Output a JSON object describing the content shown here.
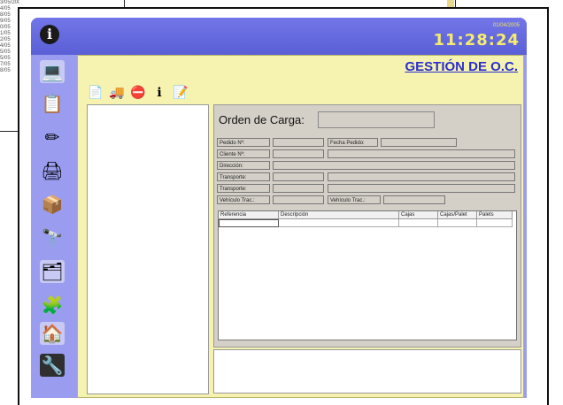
{
  "background": {
    "dates": [
      "3/05/2004",
      "4/05",
      "8/05",
      "9/05",
      "0/05",
      "1/05",
      "2/05",
      "4/05",
      "5/05",
      "5/05",
      "7/05",
      "8/05"
    ]
  },
  "header": {
    "info_icon": "i",
    "date": "01/04/2005",
    "time": "11:28:24"
  },
  "sidebar": {
    "items": [
      {
        "name": "computers-icon",
        "glyph": "💻"
      },
      {
        "name": "clipboard-icon",
        "glyph": "📋"
      },
      {
        "name": "pencil-icon",
        "glyph": "✏"
      },
      {
        "name": "printer-icon",
        "glyph": "🖨"
      },
      {
        "name": "boxes-icon",
        "glyph": "📦"
      },
      {
        "name": "binoculars-icon",
        "glyph": "🔭"
      },
      {
        "name": "network-icon",
        "glyph": "🗂"
      },
      {
        "name": "puzzle-icon",
        "glyph": "🧩"
      },
      {
        "name": "home-icon",
        "glyph": "🏠"
      },
      {
        "name": "tools-icon",
        "glyph": "🔧"
      }
    ]
  },
  "main": {
    "title": "GESTIÓN DE O.C.",
    "toolbar": [
      {
        "name": "new-doc-icon",
        "glyph": "📄"
      },
      {
        "name": "truck-icon",
        "glyph": "🚚"
      },
      {
        "name": "stop-icon",
        "glyph": "⛔"
      },
      {
        "name": "info-icon",
        "glyph": "ℹ"
      },
      {
        "name": "edit-doc-icon",
        "glyph": "📝"
      }
    ],
    "form": {
      "order_label": "Orden de Carga:",
      "pedido_label": "Pedido Nº:",
      "fecha_label": "Fecha Pedido:",
      "cliente_label": "Cliente Nº:",
      "direccion_label": "Dirección:",
      "transporte1_label": "Transporte:",
      "transporte2_label": "Transporte:",
      "vehiculo_trac1_label": "Vehículo Trac.:",
      "vehiculo_trac2_label": "Vehículo Trac.:"
    },
    "table": {
      "columns": [
        "Referencia",
        "Descripción",
        "Cajas",
        "Cajas/Palet",
        "Palets"
      ]
    }
  }
}
